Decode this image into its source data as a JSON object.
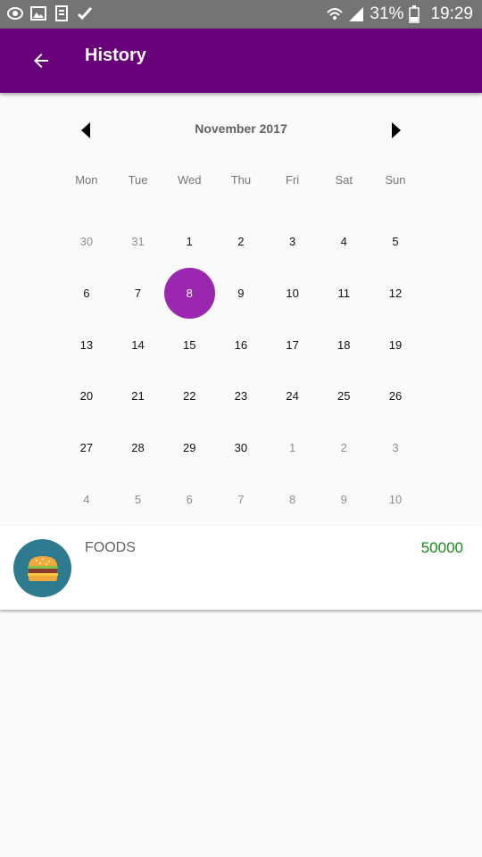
{
  "status_bar": {
    "battery": "31%",
    "time": "19:29",
    "left_icons": [
      "eye-icon",
      "image-icon",
      "book-icon",
      "check-flag-icon"
    ]
  },
  "app_bar": {
    "title": "History",
    "color": "#68007a"
  },
  "calendar": {
    "month_label": "November 2017",
    "weekdays": [
      "Mon",
      "Tue",
      "Wed",
      "Thu",
      "Fri",
      "Sat",
      "Sun"
    ],
    "selected_day": "8",
    "selected_color": "#9b27b0",
    "weeks": [
      [
        {
          "d": "30",
          "m": true
        },
        {
          "d": "31",
          "m": true
        },
        {
          "d": "1"
        },
        {
          "d": "2"
        },
        {
          "d": "3"
        },
        {
          "d": "4"
        },
        {
          "d": "5"
        }
      ],
      [
        {
          "d": "6"
        },
        {
          "d": "7"
        },
        {
          "d": "8",
          "s": true
        },
        {
          "d": "9"
        },
        {
          "d": "10"
        },
        {
          "d": "11"
        },
        {
          "d": "12"
        }
      ],
      [
        {
          "d": "13"
        },
        {
          "d": "14"
        },
        {
          "d": "15"
        },
        {
          "d": "16"
        },
        {
          "d": "17"
        },
        {
          "d": "18"
        },
        {
          "d": "19"
        }
      ],
      [
        {
          "d": "20"
        },
        {
          "d": "21"
        },
        {
          "d": "22"
        },
        {
          "d": "23"
        },
        {
          "d": "24"
        },
        {
          "d": "25"
        },
        {
          "d": "26"
        }
      ],
      [
        {
          "d": "27"
        },
        {
          "d": "28"
        },
        {
          "d": "29"
        },
        {
          "d": "30"
        },
        {
          "d": "1",
          "m": true
        },
        {
          "d": "2",
          "m": true
        },
        {
          "d": "3",
          "m": true
        }
      ],
      [
        {
          "d": "4",
          "m": true
        },
        {
          "d": "5",
          "m": true
        },
        {
          "d": "6",
          "m": true
        },
        {
          "d": "7",
          "m": true
        },
        {
          "d": "8",
          "m": true
        },
        {
          "d": "9",
          "m": true
        },
        {
          "d": "10",
          "m": true
        }
      ]
    ]
  },
  "entries": [
    {
      "category": "FOODS",
      "amount": "50000",
      "icon": "burger-icon",
      "amount_color": "#1a8a1a"
    }
  ]
}
